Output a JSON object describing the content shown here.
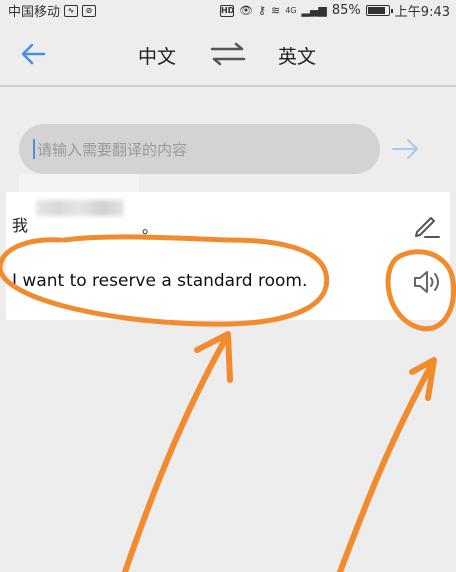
{
  "status_bar": {
    "carrier": "中国移动",
    "hd_label": "HD",
    "network": "4G",
    "battery": "85%",
    "time": "上午9:43"
  },
  "header": {
    "source_lang": "中文",
    "target_lang": "英文"
  },
  "input": {
    "placeholder": "请输入需要翻译的内容"
  },
  "result": {
    "source_prefix": "我",
    "source_suffix": "。",
    "translation": "I want to reserve a standard room."
  },
  "colors": {
    "accent": "#4a90d9",
    "annotation": "#f28a2e",
    "background": "#ededed"
  }
}
